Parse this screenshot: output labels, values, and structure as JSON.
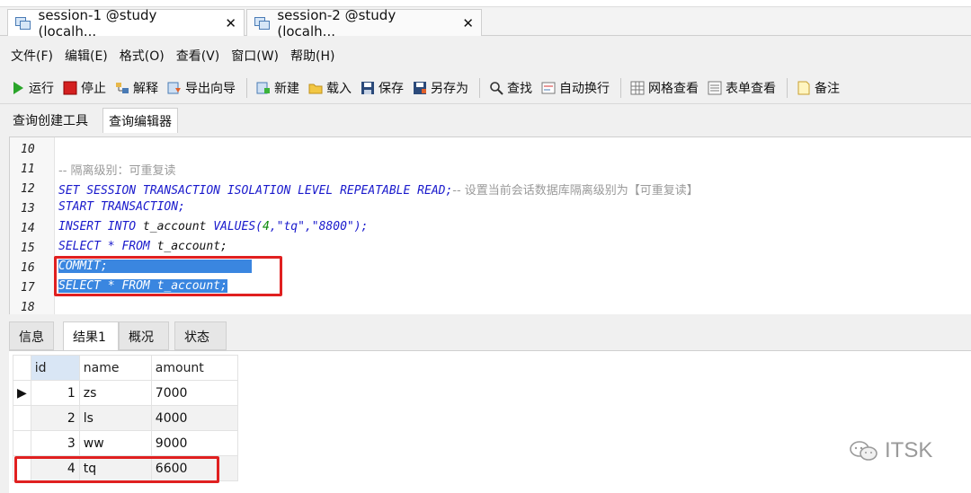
{
  "tabs": [
    {
      "label": "session-1 @study (localh...",
      "close": "✕"
    },
    {
      "label": "session-2 @study (localh...",
      "close": "✕"
    }
  ],
  "menu": [
    "文件(F)",
    "编辑(E)",
    "格式(O)",
    "查看(V)",
    "窗口(W)",
    "帮助(H)"
  ],
  "toolbar": {
    "run": "运行",
    "stop": "停止",
    "explain": "解释",
    "export_wizard": "导出向导",
    "new": "新建",
    "load": "载入",
    "save": "保存",
    "save_as": "另存为",
    "find": "查找",
    "word_wrap": "自动换行",
    "grid_view": "网格查看",
    "form_view": "表单查看",
    "note": "备注"
  },
  "subtabs": {
    "builder": "查询创建工具",
    "editor": "查询编辑器"
  },
  "code": {
    "line_numbers": [
      "10",
      "11",
      "12",
      "13",
      "14",
      "15",
      "16",
      "17",
      "18"
    ],
    "l11": "-- 隔离级别：可重复读",
    "l12_kw": "SET SESSION TRANSACTION ISOLATION LEVEL REPEATABLE READ;",
    "l12_cm": "-- 设置当前会话数据库隔离级别为【可重复读】",
    "l13": "START TRANSACTION;",
    "l14_a": "INSERT INTO",
    "l14_b": " t_account ",
    "l14_c": "VALUES(",
    "l14_num": "4",
    "l14_d": ",\"tq\",\"8800\");",
    "l15_a": "SELECT * FROM",
    "l15_b": " t_account;",
    "l16": "COMMIT;",
    "l17": "SELECT * FROM t_account;"
  },
  "result_tabs": [
    "信息",
    "结果1",
    "概况",
    "状态"
  ],
  "grid": {
    "columns": [
      "id",
      "name",
      "amount"
    ],
    "rows": [
      {
        "id": "1",
        "name": "zs",
        "amount": "7000"
      },
      {
        "id": "2",
        "name": "ls",
        "amount": "4000"
      },
      {
        "id": "3",
        "name": "ww",
        "amount": "9000"
      },
      {
        "id": "4",
        "name": "tq",
        "amount": "6600"
      }
    ],
    "current_row_marker": "▶"
  },
  "watermark": "ITSK",
  "colors": {
    "keyword": "#1a1acc",
    "comment": "#9a9a9a",
    "selection": "#3a86e0",
    "highlight_box": "#e02020"
  }
}
